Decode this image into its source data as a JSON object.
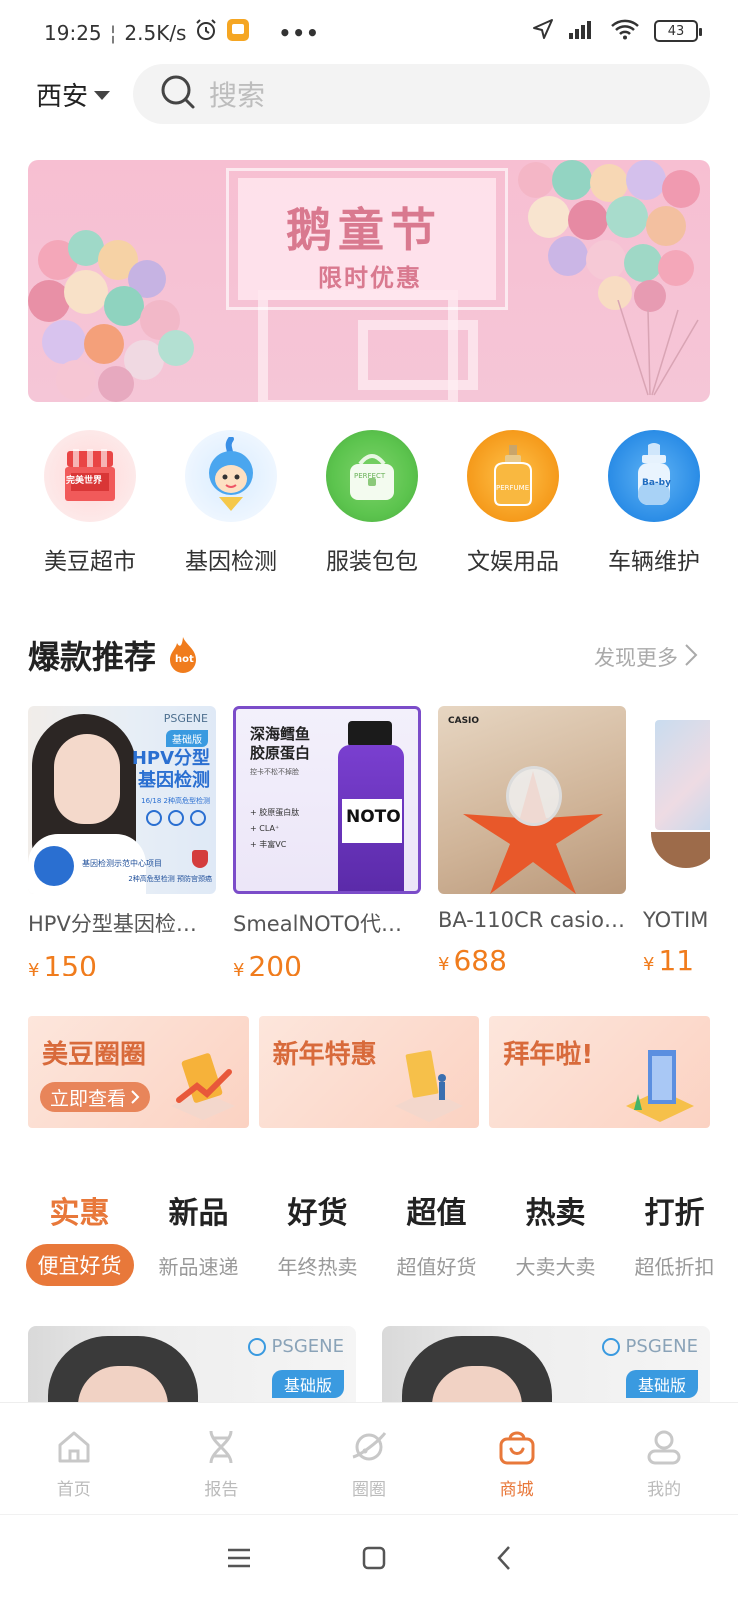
{
  "status_bar": {
    "time": "19:25",
    "speed": "2.5K/s",
    "battery": "43",
    "more": "•••"
  },
  "header": {
    "city": "西安",
    "search_placeholder": "搜索"
  },
  "banner": {
    "title": "鹅童节",
    "subtitle": "限时优惠"
  },
  "categories": [
    {
      "label": "美豆超市",
      "icon": "supermarket-icon",
      "color": "#f15a5a",
      "icon_text": "完美世界"
    },
    {
      "label": "基因检测",
      "icon": "gene-mascot-icon",
      "color": "#4aa6ef"
    },
    {
      "label": "服装包包",
      "icon": "handbag-icon",
      "color": "#5cc44e",
      "icon_text": "PERFECT"
    },
    {
      "label": "文娱用品",
      "icon": "perfume-icon",
      "color": "#f59a1b",
      "icon_text": "PERFUME"
    },
    {
      "label": "车辆维护",
      "icon": "baby-bottle-icon",
      "color": "#2a8ce6",
      "icon_text": "Ba-by"
    }
  ],
  "hot_section": {
    "title": "爆款推荐",
    "badge": "hot",
    "more": "发现更多"
  },
  "products": [
    {
      "name": "HPV分型基因检…",
      "price": "150",
      "currency": "¥",
      "image": {
        "brand": "PSGENE",
        "tag": "基础版",
        "headline": "HPV分型\n基因检测",
        "note": "16/18 2种高危型检测",
        "footer": "基因检测示范中心项目",
        "footer2": "2种高危型检测  预防宫颈癌"
      }
    },
    {
      "name": "SmealNOTO代餐…",
      "price": "200",
      "currency": "¥",
      "image": {
        "headline": "深海鳕鱼\n胶原蛋白",
        "note": "控卡不松不掉脸",
        "bullets": [
          "+ 胶原蛋白肽",
          "+ CLA⁺",
          "+ 丰富VC"
        ],
        "bottle": "NOTO"
      }
    },
    {
      "name": "BA-110CR casio…",
      "price": "688",
      "currency": "¥",
      "image": {
        "brand": "CASIO"
      }
    },
    {
      "name": "YOTIM",
      "price": "11",
      "currency": "¥",
      "image": {}
    }
  ],
  "promos": [
    {
      "title": "美豆圈圈",
      "button": "立即查看"
    },
    {
      "title": "新年特惠"
    },
    {
      "title": "拜年啦!"
    }
  ],
  "tabs": [
    {
      "title": "实惠",
      "sub": "便宜好货",
      "active": true
    },
    {
      "title": "新品",
      "sub": "新品速递"
    },
    {
      "title": "好货",
      "sub": "年终热卖"
    },
    {
      "title": "超值",
      "sub": "超值好货"
    },
    {
      "title": "热卖",
      "sub": "大卖大卖"
    },
    {
      "title": "打折",
      "sub": "超低折扣"
    }
  ],
  "feed_preview": [
    {
      "brand": "PSGENE",
      "tag": "基础版"
    },
    {
      "brand": "PSGENE",
      "tag": "基础版"
    }
  ],
  "bottom_nav": [
    {
      "label": "首页",
      "icon": "home-icon"
    },
    {
      "label": "报告",
      "icon": "dna-icon"
    },
    {
      "label": "圈圈",
      "icon": "planet-icon"
    },
    {
      "label": "商城",
      "icon": "shopping-bag-icon",
      "active": true
    },
    {
      "label": "我的",
      "icon": "user-icon"
    }
  ],
  "colors": {
    "accent": "#e8783a",
    "price": "#f07c1d",
    "banner_pink": "#f7bfd2"
  }
}
